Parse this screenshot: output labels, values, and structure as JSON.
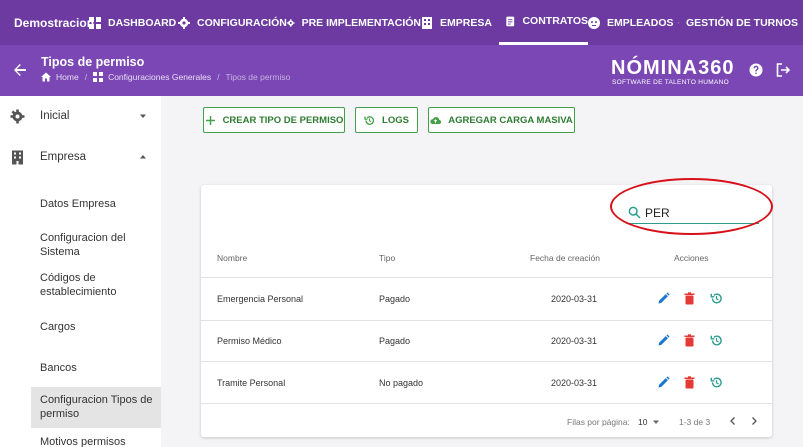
{
  "topnav": {
    "brand": "Demostracion",
    "items": [
      {
        "label": "DASHBOARD",
        "icon": "dashboard-icon"
      },
      {
        "label": "CONFIGURACIÓN",
        "icon": "gear-icon"
      },
      {
        "label": "PRE IMPLEMENTACIÓN",
        "icon": "gear-icon"
      },
      {
        "label": "EMPRESA",
        "icon": "building-icon"
      },
      {
        "label": "CONTRATOS",
        "icon": "clipboard-icon"
      },
      {
        "label": "EMPLEADOS",
        "icon": "face-icon"
      },
      {
        "label": "GESTIÓN DE TURNOS",
        "icon": "calendar-icon"
      }
    ]
  },
  "header": {
    "title": "Tipos de permiso",
    "breadcrumb": [
      "Home",
      "Configuraciones Generales",
      "Tipos de permiso"
    ],
    "logo_text": "NÓMINA360",
    "logo_subtitle": "SOFTWARE DE TALENTO HUMANO"
  },
  "sidebar": {
    "sections": [
      {
        "label": "Inicial",
        "icon": "gear-icon",
        "expanded": false
      },
      {
        "label": "Empresa",
        "icon": "building-icon",
        "expanded": true
      }
    ],
    "sub_items": [
      "Datos Empresa",
      "Configuracion del Sistema",
      "Códigos de establecimiento",
      "Cargos",
      "Bancos",
      "Configuracion Tipos de permiso",
      "Motivos permisos"
    ],
    "active_sub_item": "Configuracion Tipos de permiso"
  },
  "actions": {
    "create_label": "CREAR TIPO DE PERMISO",
    "logs_label": "LOGS",
    "bulk_label": "AGREGAR CARGA MASIVA"
  },
  "search": {
    "value": "PER"
  },
  "table": {
    "headers": [
      "Nombre",
      "Tipo",
      "Fecha de creación",
      "Acciones"
    ],
    "rows": [
      {
        "nombre": "Emergencia Personal",
        "tipo": "Pagado",
        "fecha": "2020-03-31"
      },
      {
        "nombre": "Permiso Médico",
        "tipo": "Pagado",
        "fecha": "2020-03-31"
      },
      {
        "nombre": "Tramite Personal",
        "tipo": "No pagado",
        "fecha": "2020-03-31"
      }
    ]
  },
  "pagination": {
    "rows_per_page_label": "Filas por página:",
    "rows_per_page": "10",
    "range": "1-3 de 3"
  },
  "colors": {
    "nav": "#6c3aa1",
    "header": "#7b47b5",
    "accent_green": "#43a047",
    "edit_blue": "#1976d2",
    "delete_red": "#e53935",
    "history_teal": "#2a9d8f",
    "highlight_red": "#d7101a"
  }
}
